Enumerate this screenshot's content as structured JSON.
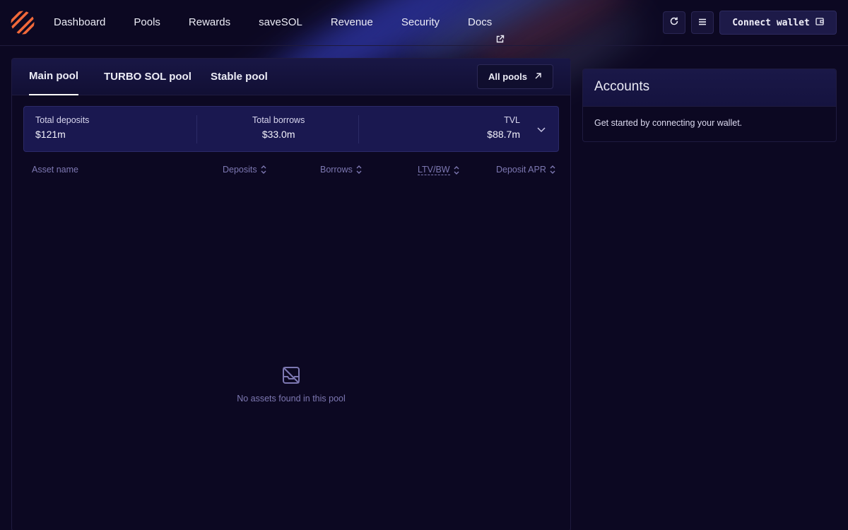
{
  "header": {
    "nav": [
      {
        "label": "Dashboard"
      },
      {
        "label": "Pools"
      },
      {
        "label": "Rewards"
      },
      {
        "label": "saveSOL"
      },
      {
        "label": "Revenue"
      },
      {
        "label": "Security"
      },
      {
        "label": "Docs",
        "icon": "external-link-icon"
      }
    ],
    "refresh_icon": "refresh-icon",
    "menu_icon": "menu-icon",
    "connect_label": "Connect wallet",
    "connect_icon": "wallet-icon"
  },
  "pool": {
    "tabs": [
      {
        "label": "Main pool",
        "active": true
      },
      {
        "label": "TURBO SOL pool",
        "active": false
      },
      {
        "label": "Stable pool",
        "active": false
      }
    ],
    "all_pools_label": "All pools",
    "stats": {
      "deposits_label": "Total deposits",
      "deposits_value": "$121m",
      "borrows_label": "Total borrows",
      "borrows_value": "$33.0m",
      "tvl_label": "TVL",
      "tvl_value": "$88.7m"
    },
    "columns": {
      "asset": "Asset name",
      "deposits": "Deposits",
      "borrows": "Borrows",
      "ltv": "LTV/BW",
      "apr": "Deposit APR"
    },
    "empty_text": "No assets found in this pool"
  },
  "accounts": {
    "title": "Accounts",
    "message": "Get started by connecting your wallet."
  },
  "colors": {
    "background": "#0c0822",
    "panel": "#1a1850",
    "muted": "#7d78b2",
    "logo_orange": "#f2693a"
  }
}
